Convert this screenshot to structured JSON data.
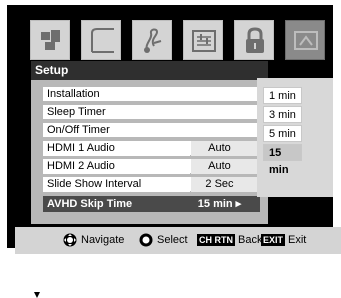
{
  "tabs": [
    {
      "name": "picture-tab",
      "icon": "picture-icon",
      "active": false
    },
    {
      "name": "audio-tab",
      "icon": "audio-icon",
      "active": false
    },
    {
      "name": "music-tab",
      "icon": "music-icon",
      "active": false
    },
    {
      "name": "preferences-tab",
      "icon": "preferences-icon",
      "active": false
    },
    {
      "name": "lock-tab",
      "icon": "lock-icon",
      "active": false
    },
    {
      "name": "setup-tab",
      "icon": "setup-icon",
      "active": true
    }
  ],
  "panel": {
    "title": "Setup",
    "rows": [
      {
        "label": "Installation",
        "value": ""
      },
      {
        "label": "Sleep Timer",
        "value": ""
      },
      {
        "label": "On/Off Timer",
        "value": ""
      },
      {
        "label": "HDMI 1 Audio",
        "value": "Auto"
      },
      {
        "label": "HDMI 2 Audio",
        "value": "Auto"
      },
      {
        "label": "Slide Show Interval",
        "value": "2 Sec"
      },
      {
        "label": "AVHD Skip Time",
        "value": "15 min ▸",
        "selected": true
      }
    ]
  },
  "options": [
    {
      "label": "1 min"
    },
    {
      "label": "3 min"
    },
    {
      "label": "5 min"
    },
    {
      "label": "15 min",
      "selected": true
    }
  ],
  "help": {
    "navigate_label": "Navigate",
    "select_label": "Select",
    "back_key": "CH RTN",
    "back_label": "Back",
    "exit_key": "EXIT",
    "exit_label": "Exit"
  }
}
